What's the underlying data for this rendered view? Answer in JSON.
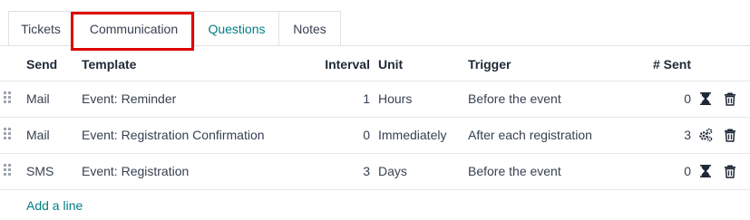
{
  "tabs": [
    {
      "label": "Tickets"
    },
    {
      "label": "Communication"
    },
    {
      "label": "Questions"
    },
    {
      "label": "Notes"
    }
  ],
  "table": {
    "headers": {
      "send": "Send",
      "template": "Template",
      "interval": "Interval",
      "unit": "Unit",
      "trigger": "Trigger",
      "sent": "# Sent"
    },
    "rows": [
      {
        "send": "Mail",
        "template": "Event: Reminder",
        "interval": "1",
        "unit": "Hours",
        "trigger": "Before the event",
        "sent": "0",
        "status_icon": "hourglass-icon"
      },
      {
        "send": "Mail",
        "template": "Event: Registration Confirmation",
        "interval": "0",
        "unit": "Immediately",
        "trigger": "After each registration",
        "sent": "3",
        "status_icon": "gears-icon"
      },
      {
        "send": "SMS",
        "template": "Event: Registration",
        "interval": "3",
        "unit": "Days",
        "trigger": "Before the event",
        "sent": "0",
        "status_icon": "hourglass-icon"
      }
    ],
    "add_line": "Add a line"
  },
  "colors": {
    "link": "#017e84",
    "highlight": "#e00000",
    "border": "#dee2e6"
  }
}
